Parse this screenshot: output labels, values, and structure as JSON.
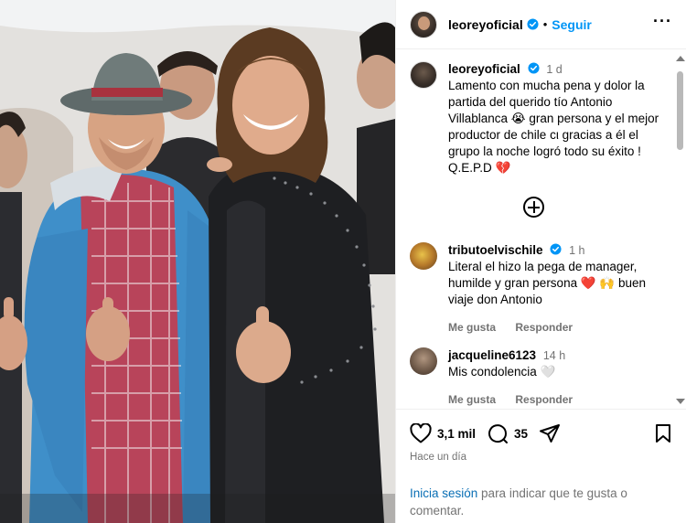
{
  "post": {
    "username": "leoreyoficial",
    "follow_label": "Seguir",
    "more_icon": "more-options-icon"
  },
  "caption": {
    "username": "leoreyoficial",
    "time": "1 d",
    "text": "Lamento con mucha pena y dolor la partida del querido tío Antonio Villablanca 😭 gran persona y el mejor productor de chile cι gracias a él el grupo la noche logró todo su éxito ! Q.E.P.D 💔"
  },
  "comments": [
    {
      "username": "tributoelvischile",
      "verified": true,
      "time": "1 h",
      "text": "Literal el hizo la pega de manager, humilde y gran persona ❤️ 🙌 buen viaje don Antonio",
      "like_label": "Me gusta",
      "reply_label": "Responder"
    },
    {
      "username": "jacqueline6123",
      "verified": false,
      "time": "14 h",
      "text": "Mis condolencia 🤍",
      "like_label": "Me gusta",
      "reply_label": "Responder"
    }
  ],
  "stats": {
    "likes": "3,1 mil",
    "comments": "35",
    "posted": "Hace un día"
  },
  "login_prompt": {
    "link": "Inicia sesión",
    "text": " para indicar que te gusta o comentar."
  },
  "colors": {
    "accent": "#0095f6",
    "muted": "#737373",
    "heart": "#e0245e"
  }
}
